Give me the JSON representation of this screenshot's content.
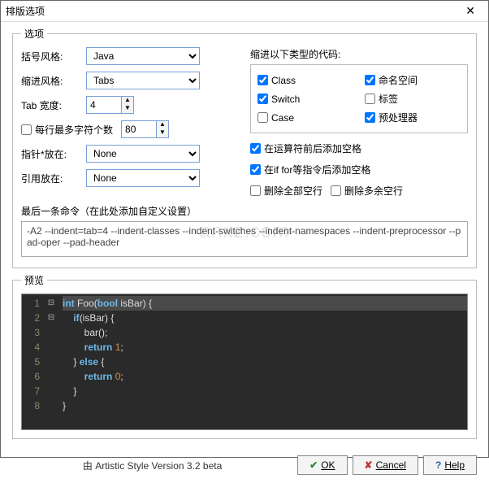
{
  "window": {
    "title": "排版选项"
  },
  "groups": {
    "options": "选项",
    "indent_types": "缩进以下类型的代码:",
    "last_cmd": "最后一条命令（在此处添加自定义设置）",
    "preview": "预览"
  },
  "labels": {
    "brace_style": "括号风格:",
    "indent_style": "缩进风格:",
    "tab_width": "Tab 宽度:",
    "max_chars": "每行最多字符个数",
    "pointer": "指针*放在:",
    "reference": "引用放在:"
  },
  "selects": {
    "brace_style": "Java",
    "indent_style": "Tabs",
    "pointer": "None",
    "reference": "None"
  },
  "spins": {
    "tab_width": "4",
    "max_chars": "80"
  },
  "indent_checks": {
    "class": {
      "label": "Class",
      "checked": true
    },
    "namespace": {
      "label": "命名空间",
      "checked": true
    },
    "switch": {
      "label": "Switch",
      "checked": true
    },
    "label": {
      "label": "标签",
      "checked": false
    },
    "case": {
      "label": "Case",
      "checked": false
    },
    "preprocessor": {
      "label": "预处理器",
      "checked": true
    }
  },
  "extra_checks": {
    "pad_oper": {
      "label": "在运算符前后添加空格",
      "checked": true
    },
    "pad_header": {
      "label": "在if for等指令后添加空格",
      "checked": true
    },
    "del_all_blank": {
      "label": "删除全部空行",
      "checked": false
    },
    "del_extra_blank": {
      "label": "删除多余空行",
      "checked": false
    }
  },
  "max_chars_enabled": false,
  "cmd_text": "-A2 --indent=tab=4 --indent-classes --indent-switches --indent-namespaces --indent-preprocessor --pad-oper --pad-header",
  "preview_code": {
    "lines": [
      "int Foo(bool isBar) {",
      "    if(isBar) {",
      "        bar();",
      "        return 1;",
      "    } else {",
      "        return 0;",
      "    }",
      "}"
    ]
  },
  "footer": {
    "credit": "由 Artistic Style Version 3.2 beta",
    "ok": "OK",
    "cancel": "Cancel",
    "help": "Help"
  },
  "watermark": "anxz.com"
}
